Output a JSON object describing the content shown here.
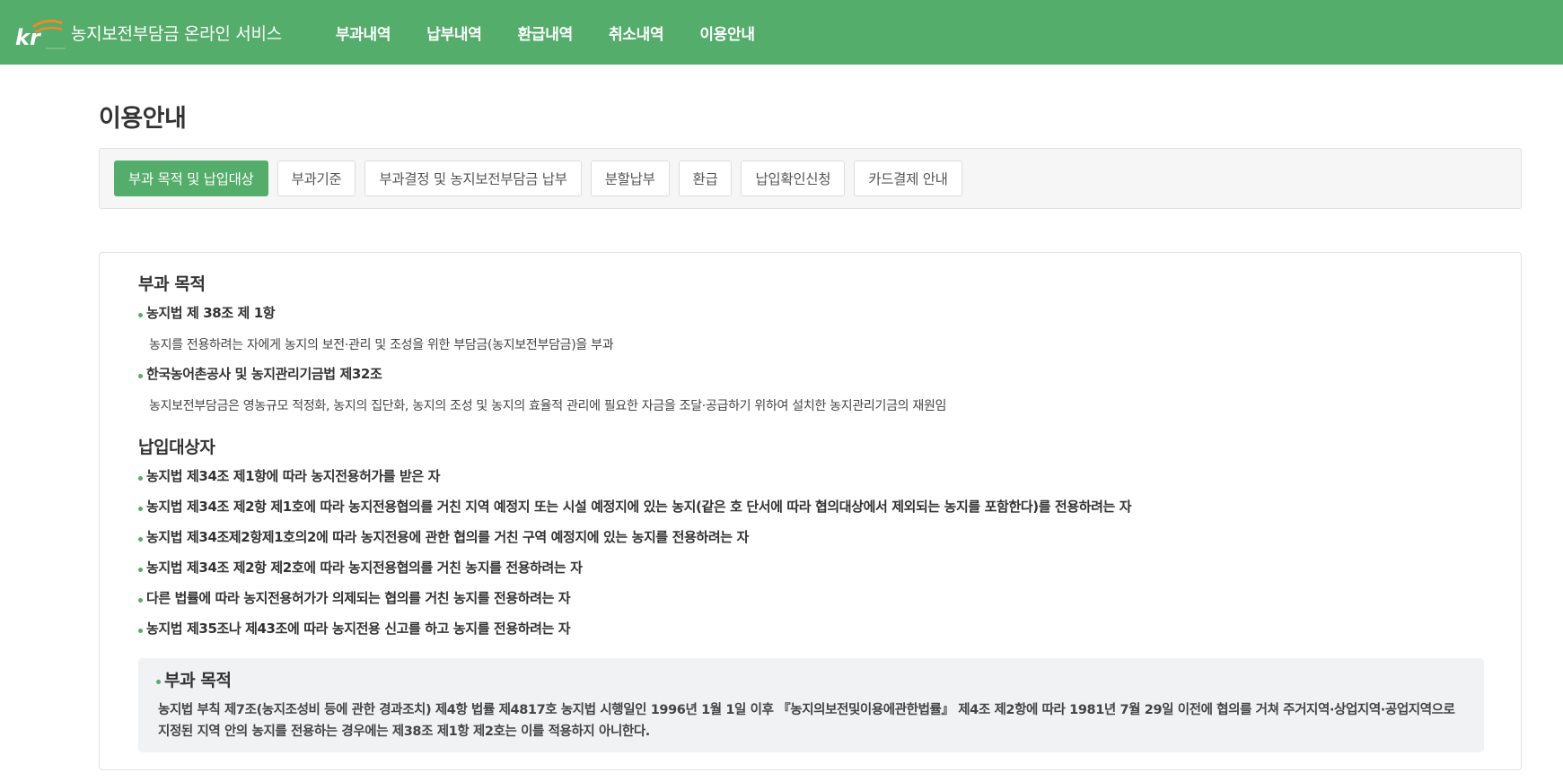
{
  "header": {
    "service_title": "농지보전부담금 온라인 서비스",
    "logo_text": "kr",
    "nav": [
      "부과내역",
      "납부내역",
      "환급내역",
      "취소내역",
      "이용안내"
    ]
  },
  "page": {
    "title": "이용안내"
  },
  "tabs": [
    {
      "label": "부과 목적 및 납입대상",
      "active": true
    },
    {
      "label": "부과기준",
      "active": false
    },
    {
      "label": "부과결정 및 농지보전부담금 납부",
      "active": false
    },
    {
      "label": "분할납부",
      "active": false
    },
    {
      "label": "환급",
      "active": false
    },
    {
      "label": "납입확인신청",
      "active": false
    },
    {
      "label": "카드결제 안내",
      "active": false
    }
  ],
  "content": {
    "purpose": {
      "title": "부과 목적",
      "items": [
        {
          "heading": "농지법 제 38조 제 1항",
          "desc": "농지를 전용하려는 자에게 농지의 보전·관리 및 조성을 위한 부담금(농지보전부담금)을 부과"
        },
        {
          "heading": "한국농어촌공사 및 농지관리기금법 제32조",
          "desc": "농지보전부담금은 영농규모 적정화, 농지의 집단화, 농지의 조성 및 농지의 효율적 관리에 필요한 자금을 조달·공급하기 위하여 설치한 농지관리기금의 재원임"
        }
      ]
    },
    "payers": {
      "title": "납입대상자",
      "items": [
        "농지법 제34조 제1항에 따라 농지전용허가를 받은 자",
        "농지법 제34조 제2항 제1호에 따라 농지전용협의를 거친 지역 예정지 또는 시설 예정지에 있는 농지(같은 호 단서에 따라 협의대상에서 제외되는 농지를 포함한다)를 전용하려는 자",
        "농지법 제34조제2항제1호의2에 따라 농지전용에 관한 협의를 거친 구역 예정지에 있는 농지를 전용하려는 자",
        "농지법 제34조 제2항 제2호에 따라 농지전용협의를 거친 농지를 전용하려는 자",
        "다른 법률에 따라 농지전용허가가 의제되는 협의를 거친 농지를 전용하려는 자",
        "농지법 제35조나 제43조에 따라 농지전용 신고를 하고 농지를 전용하려는 자"
      ]
    },
    "note": {
      "title": "부과 목적",
      "text": "농지법 부칙 제7조(농지조성비 등에 관한 경과조치) 제4항 법률 제4817호 농지법 시행일인 1996년 1월 1일 이후 『농지의보전및이용에관한법률』 제4조 제2항에 따라 1981년 7월 29일 이전에 협의를 거쳐 주거지역·상업지역·공업지역으로 지정된 지역 안의 농지를 전용하는 경우에는 제38조 제1항 제2호는 이를 적용하지 아니한다."
    }
  },
  "colors": {
    "brand_green": "#54ad6a",
    "accent_orange": "#f08a24"
  }
}
